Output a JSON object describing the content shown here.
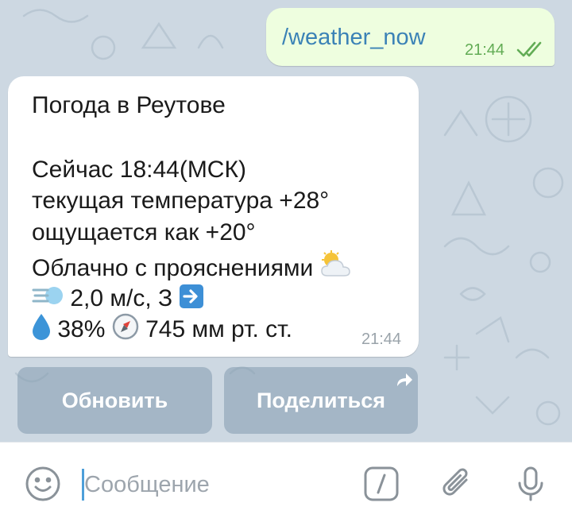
{
  "chat": {
    "outgoing": {
      "text": "/weather_now",
      "time": "21:44",
      "status": "read"
    },
    "incoming": {
      "lines": [
        "Погода в Реутове",
        "",
        "Сейчас 18:44(МСК)",
        "текущая температура +28°",
        "ощущается как +20°",
        "Облачно с прояснениями"
      ],
      "wind_text": "2,0 м/с, З",
      "humidity_text": "38%",
      "pressure_text": "745 мм рт. ст.",
      "time": "21:44",
      "icons": [
        "sun-behind-cloud-icon",
        "wind-face-icon",
        "right-arrow-icon",
        "droplet-icon",
        "compass-icon"
      ]
    }
  },
  "keyboard": {
    "refresh_label": "Обновить",
    "share_label": "Поделиться"
  },
  "composer": {
    "placeholder": "Сообщение"
  },
  "colors": {
    "chat_background": "#cdd8e2",
    "outgoing_bubble": "#eefedf",
    "outgoing_text": "#3b82b6",
    "outgoing_time": "#62ac55",
    "button_bg": "#849aae",
    "accent": "#4d9fd9"
  }
}
